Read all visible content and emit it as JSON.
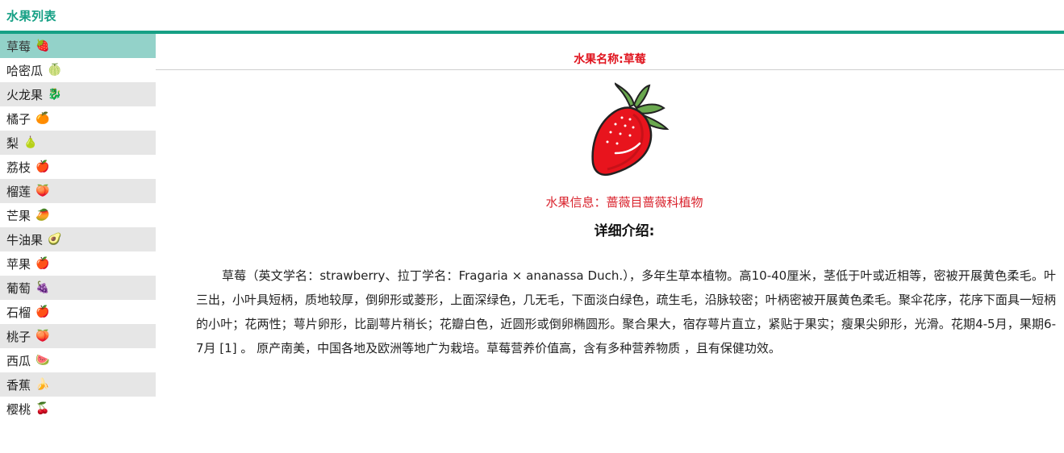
{
  "header": {
    "title": "水果列表"
  },
  "sidebar": {
    "items": [
      {
        "label": "草莓",
        "icon": "strawberry-icon",
        "emoji": "🍓",
        "active": true
      },
      {
        "label": "哈密瓜",
        "icon": "melon-icon",
        "emoji": "🍈"
      },
      {
        "label": "火龙果",
        "icon": "dragon-fruit-icon",
        "emoji": "🐉"
      },
      {
        "label": "橘子",
        "icon": "orange-icon",
        "emoji": "🍊"
      },
      {
        "label": "梨",
        "icon": "pear-icon",
        "emoji": "🍐"
      },
      {
        "label": "荔枝",
        "icon": "lychee-icon",
        "emoji": "🍎"
      },
      {
        "label": "榴莲",
        "icon": "durian-icon",
        "emoji": "🍑"
      },
      {
        "label": "芒果",
        "icon": "mango-icon",
        "emoji": "🥭"
      },
      {
        "label": "牛油果",
        "icon": "avocado-icon",
        "emoji": "🥑"
      },
      {
        "label": "苹果",
        "icon": "apple-icon",
        "emoji": "🍎"
      },
      {
        "label": "葡萄",
        "icon": "grape-icon",
        "emoji": "🍇"
      },
      {
        "label": "石榴",
        "icon": "pomegranate-icon",
        "emoji": "🍎"
      },
      {
        "label": "桃子",
        "icon": "peach-icon",
        "emoji": "🍑"
      },
      {
        "label": "西瓜",
        "icon": "watermelon-icon",
        "emoji": "🍉"
      },
      {
        "label": "香蕉",
        "icon": "banana-icon",
        "emoji": "🍌"
      },
      {
        "label": "樱桃",
        "icon": "cherry-icon",
        "emoji": "🍒"
      }
    ]
  },
  "main": {
    "name_label": "水果名称:草莓",
    "image_icon": "strawberry-icon",
    "info": "水果信息：蔷薇目蔷薇科植物",
    "detail_title": "详细介绍:",
    "detail_text": "草莓（英文学名：strawberry、拉丁学名：Fragaria × ananassa Duch.），多年生草本植物。高10-40厘米，茎低于叶或近相等，密被开展黄色柔毛。叶三出，小叶具短柄，质地较厚，倒卵形或菱形，上面深绿色，几无毛，下面淡白绿色，疏生毛，沿脉较密；叶柄密被开展黄色柔毛。聚伞花序，花序下面具一短柄的小叶；花两性；萼片卵形，比副萼片稍长；花瓣白色，近圆形或倒卵椭圆形。聚合果大，宿存萼片直立，紧贴于果实；瘦果尖卵形，光滑。花期4-5月，果期6-7月 [1] 。 原产南美，中国各地及欧洲等地广为栽培。草莓营养价值高，含有多种营养物质 ，且有保健功效。"
  },
  "colors": {
    "accent": "#16a085",
    "active_item": "#93d2c9",
    "alt_row": "#e6e6e6",
    "title_red": "#e0141e"
  }
}
